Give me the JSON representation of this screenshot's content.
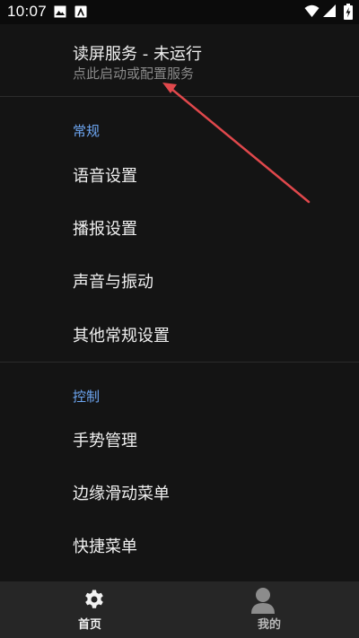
{
  "status_bar": {
    "time": "10:07",
    "left_icons": [
      "image-icon",
      "app-notification-icon"
    ],
    "right_icons": [
      "wifi-icon",
      "signal-icon",
      "battery-charging-icon"
    ]
  },
  "service": {
    "title": "读屏服务 - 未运行",
    "subtitle": "点此启动或配置服务"
  },
  "sections": [
    {
      "header": "常规",
      "items": [
        "语音设置",
        "播报设置",
        "声音与振动",
        "其他常规设置"
      ]
    },
    {
      "header": "控制",
      "items": [
        "手势管理",
        "边缘滑动菜单",
        "快捷菜单"
      ]
    }
  ],
  "bottom_nav": {
    "tabs": [
      {
        "label": "首页",
        "icon": "gear-icon",
        "active": true
      },
      {
        "label": "我的",
        "icon": "person-icon",
        "active": false
      }
    ]
  },
  "colors": {
    "background": "#141414",
    "accent": "#6da6f2",
    "annotation_arrow": "#e0484c",
    "nav_background": "#262626"
  }
}
